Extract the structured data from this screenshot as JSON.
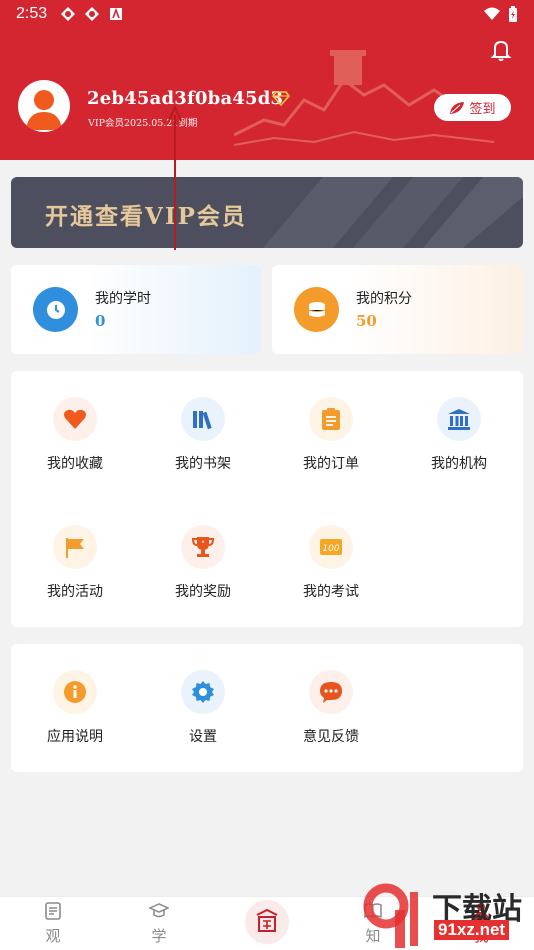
{
  "status_bar": {
    "time": "2:53"
  },
  "profile": {
    "username": "2eb45ad3f0ba45d3",
    "vip_expire": "VIP会员2025.05.21到期",
    "checkin_label": "签到"
  },
  "vip_banner": {
    "text": "开通查看VIP会员"
  },
  "stats": [
    {
      "label": "我的学时",
      "value": "0",
      "icon": "clock-icon",
      "color": "#2f8fdd"
    },
    {
      "label": "我的积分",
      "value": "50",
      "icon": "coins-icon",
      "color": "#f39c2b"
    }
  ],
  "menu_main": [
    {
      "label": "我的收藏",
      "icon": "heart-icon"
    },
    {
      "label": "我的书架",
      "icon": "bookshelf-icon"
    },
    {
      "label": "我的订单",
      "icon": "clipboard-icon"
    },
    {
      "label": "我的机构",
      "icon": "institution-icon"
    },
    {
      "label": "我的活动",
      "icon": "flag-icon"
    },
    {
      "label": "我的奖励",
      "icon": "trophy-icon"
    },
    {
      "label": "我的考试",
      "icon": "exam-score-icon"
    }
  ],
  "menu_other": [
    {
      "label": "应用说明",
      "icon": "info-icon"
    },
    {
      "label": "设置",
      "icon": "gear-icon"
    },
    {
      "label": "意见反馈",
      "icon": "chat-bubble-icon"
    }
  ],
  "bottom_nav": [
    {
      "label": "观",
      "icon": "document-icon"
    },
    {
      "label": "学",
      "icon": "graduation-cap-icon"
    },
    {
      "label": "",
      "icon": "seal-logo-icon"
    },
    {
      "label": "知",
      "icon": "book-icon"
    },
    {
      "label": "我",
      "icon": "user-icon"
    }
  ],
  "watermark": {
    "title": "下载站",
    "url": "91xz.net"
  },
  "colors": {
    "header_red": "#d42630",
    "vip_gold": "#e6c89a",
    "banner_gray": "#4d4e5e",
    "blue": "#2f8fdd",
    "orange": "#f39c2b"
  }
}
